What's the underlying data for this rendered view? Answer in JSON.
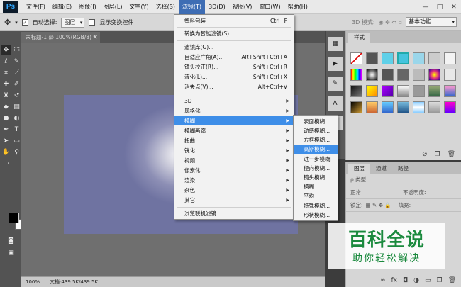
{
  "app": {
    "logo": "Ps"
  },
  "menubar": {
    "items": [
      "文件(F)",
      "编辑(E)",
      "图像(I)",
      "图层(L)",
      "文字(Y)",
      "选择(S)",
      "滤镜(T)",
      "3D(D)",
      "视图(V)",
      "窗口(W)",
      "帮助(H)"
    ],
    "window_controls": [
      "—",
      "□",
      "✕"
    ]
  },
  "options": {
    "auto_select_label": "自动选择:",
    "auto_select_target": "图层",
    "show_transform_label": "显示变换控件",
    "mode_label": "3D 模式:",
    "workspace": "基本功能"
  },
  "document": {
    "tab_title": "未标题-1 @ 100%(RGB/8) *",
    "zoom": "100%",
    "status": "文档:439.5K/439.5K"
  },
  "filter_menu": {
    "items": [
      {
        "label": "塑料包装",
        "shortcut": "Ctrl+F"
      },
      {
        "label": "转换为智能滤镜(S)"
      },
      {
        "label": "滤镜库(G)..."
      },
      {
        "label": "自适应广角(A)...",
        "shortcut": "Alt+Shift+Ctrl+A"
      },
      {
        "label": "镜头校正(R)...",
        "shortcut": "Shift+Ctrl+R"
      },
      {
        "label": "液化(L)...",
        "shortcut": "Shift+Ctrl+X"
      },
      {
        "label": "消失点(V)...",
        "shortcut": "Alt+Ctrl+V"
      },
      {
        "label": "3D"
      },
      {
        "label": "风格化"
      },
      {
        "label": "模糊"
      },
      {
        "label": "模糊画廊"
      },
      {
        "label": "扭曲"
      },
      {
        "label": "锐化"
      },
      {
        "label": "视频"
      },
      {
        "label": "像素化"
      },
      {
        "label": "渲染"
      },
      {
        "label": "杂色"
      },
      {
        "label": "其它"
      },
      {
        "label": "浏览联机滤镜..."
      }
    ]
  },
  "blur_submenu": {
    "items": [
      "表面模糊...",
      "动感模糊...",
      "方框模糊...",
      "高斯模糊...",
      "进一步模糊",
      "径向模糊...",
      "镜头模糊...",
      "模糊",
      "平均",
      "特殊模糊...",
      "形状模糊..."
    ]
  },
  "styles_panel": {
    "tab": "样式"
  },
  "layers_panel": {
    "tabs": [
      "图层",
      "通道",
      "路径"
    ],
    "filter_label": "ρ 类型",
    "blend_mode": "正常",
    "opacity_label": "不透明度:",
    "lock_label": "锁定:",
    "fill_label": "填充:"
  },
  "watermark": {
    "title": "百科全说",
    "subtitle": "助你轻松解决"
  }
}
